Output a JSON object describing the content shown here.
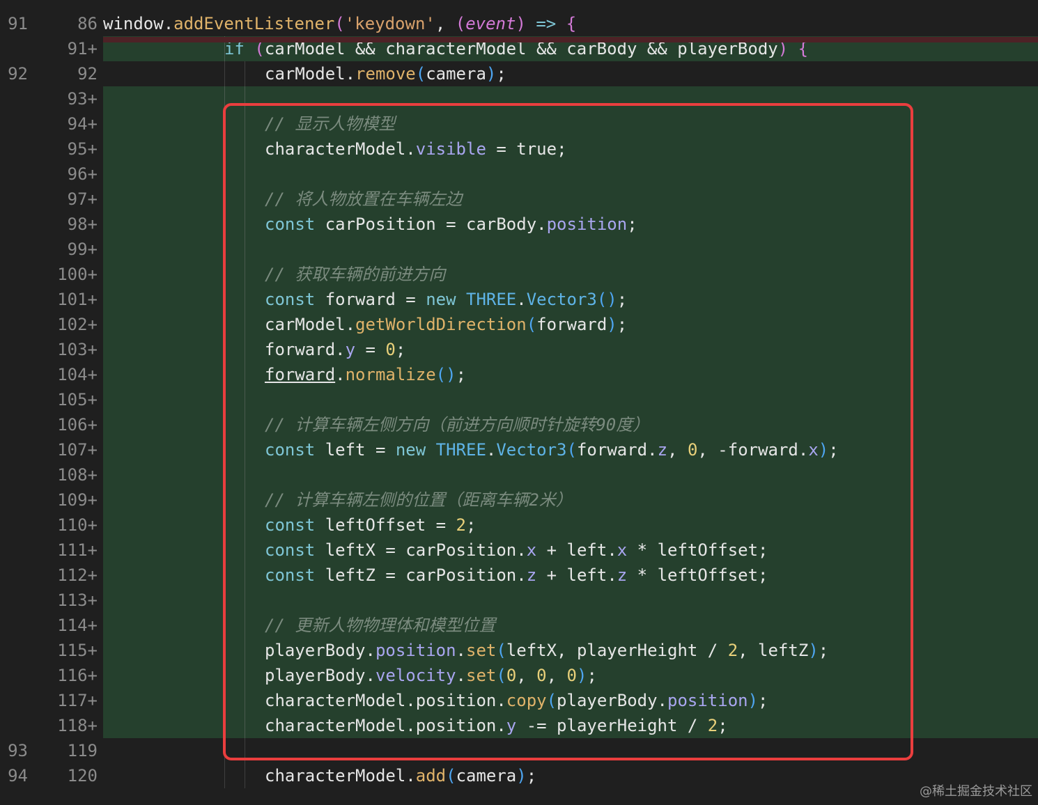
{
  "editor": {
    "lines": [
      {
        "old": "91",
        "new": "86",
        "type": "context",
        "indent": 0,
        "tokens": [
          {
            "t": "window",
            "c": "id"
          },
          {
            "t": ".",
            "c": "op"
          },
          {
            "t": "addEventListener",
            "c": "fn"
          },
          {
            "t": "(",
            "c": "pp"
          },
          {
            "t": "'keydown'",
            "c": "str"
          },
          {
            "t": ", ",
            "c": "op"
          },
          {
            "t": "(",
            "c": "pp"
          },
          {
            "t": "event",
            "c": "par"
          },
          {
            "t": ")",
            "c": "pp"
          },
          {
            "t": " => ",
            "c": "kw"
          },
          {
            "t": "{",
            "c": "pp"
          }
        ]
      },
      {
        "old": "",
        "new": "91+",
        "type": "added",
        "indent": 1,
        "tokens": [
          {
            "t": "if ",
            "c": "kw"
          },
          {
            "t": "(",
            "c": "pp"
          },
          {
            "t": "carModel && characterModel && carBody && playerBody",
            "c": "id"
          },
          {
            "t": ") ",
            "c": "pp"
          },
          {
            "t": "{",
            "c": "pp"
          }
        ]
      },
      {
        "old": "92",
        "new": "92",
        "type": "context",
        "indent": 2,
        "tokens": [
          {
            "t": "carModel",
            "c": "id"
          },
          {
            "t": ".",
            "c": "op"
          },
          {
            "t": "remove",
            "c": "fn"
          },
          {
            "t": "(",
            "c": "pn"
          },
          {
            "t": "camera",
            "c": "id"
          },
          {
            "t": ")",
            "c": "pn"
          },
          {
            "t": ";",
            "c": "op"
          }
        ]
      },
      {
        "old": "",
        "new": "93+",
        "type": "added",
        "indent": 2,
        "tokens": []
      },
      {
        "old": "",
        "new": "94+",
        "type": "added",
        "indent": 2,
        "tokens": [
          {
            "t": "// 显示人物模型",
            "c": "cmt"
          }
        ]
      },
      {
        "old": "",
        "new": "95+",
        "type": "added",
        "indent": 2,
        "tokens": [
          {
            "t": "characterModel",
            "c": "id"
          },
          {
            "t": ".",
            "c": "op"
          },
          {
            "t": "visible",
            "c": "prop"
          },
          {
            "t": " = ",
            "c": "op"
          },
          {
            "t": "true",
            "c": "id"
          },
          {
            "t": ";",
            "c": "op"
          }
        ]
      },
      {
        "old": "",
        "new": "96+",
        "type": "added",
        "indent": 2,
        "tokens": []
      },
      {
        "old": "",
        "new": "97+",
        "type": "added",
        "indent": 2,
        "tokens": [
          {
            "t": "// 将人物放置在车辆左边",
            "c": "cmt"
          }
        ]
      },
      {
        "old": "",
        "new": "98+",
        "type": "added",
        "indent": 2,
        "tokens": [
          {
            "t": "const ",
            "c": "kw"
          },
          {
            "t": "carPosition = carBody",
            "c": "id"
          },
          {
            "t": ".",
            "c": "op"
          },
          {
            "t": "position",
            "c": "prop"
          },
          {
            "t": ";",
            "c": "op"
          }
        ]
      },
      {
        "old": "",
        "new": "99+",
        "type": "added",
        "indent": 2,
        "tokens": []
      },
      {
        "old": "",
        "new": "100+",
        "type": "added",
        "indent": 2,
        "tokens": [
          {
            "t": "// 获取车辆的前进方向",
            "c": "cmt"
          }
        ]
      },
      {
        "old": "",
        "new": "101+",
        "type": "added",
        "indent": 2,
        "tokens": [
          {
            "t": "const ",
            "c": "kw"
          },
          {
            "t": "forward = ",
            "c": "id"
          },
          {
            "t": "new ",
            "c": "kw"
          },
          {
            "t": "THREE",
            "c": "cls"
          },
          {
            "t": ".",
            "c": "op"
          },
          {
            "t": "Vector3",
            "c": "cls"
          },
          {
            "t": "()",
            "c": "pn"
          },
          {
            "t": ";",
            "c": "op"
          }
        ]
      },
      {
        "old": "",
        "new": "102+",
        "type": "added",
        "indent": 2,
        "tokens": [
          {
            "t": "carModel",
            "c": "id"
          },
          {
            "t": ".",
            "c": "op"
          },
          {
            "t": "getWorldDirection",
            "c": "fn"
          },
          {
            "t": "(",
            "c": "pn"
          },
          {
            "t": "forward",
            "c": "id"
          },
          {
            "t": ")",
            "c": "pn"
          },
          {
            "t": ";",
            "c": "op"
          }
        ]
      },
      {
        "old": "",
        "new": "103+",
        "type": "added",
        "indent": 2,
        "tokens": [
          {
            "t": "forward",
            "c": "id"
          },
          {
            "t": ".",
            "c": "op"
          },
          {
            "t": "y",
            "c": "prop"
          },
          {
            "t": " = ",
            "c": "op"
          },
          {
            "t": "0",
            "c": "num"
          },
          {
            "t": ";",
            "c": "op"
          }
        ]
      },
      {
        "old": "",
        "new": "104+",
        "type": "added",
        "indent": 2,
        "tokens": [
          {
            "t": "forward",
            "c": "id under"
          },
          {
            "t": ".",
            "c": "op"
          },
          {
            "t": "normalize",
            "c": "fn"
          },
          {
            "t": "()",
            "c": "pn"
          },
          {
            "t": ";",
            "c": "op"
          }
        ]
      },
      {
        "old": "",
        "new": "105+",
        "type": "added",
        "indent": 2,
        "tokens": []
      },
      {
        "old": "",
        "new": "106+",
        "type": "added",
        "indent": 2,
        "tokens": [
          {
            "t": "// 计算车辆左侧方向（前进方向顺时针旋转90度）",
            "c": "cmt"
          }
        ]
      },
      {
        "old": "",
        "new": "107+",
        "type": "added",
        "indent": 2,
        "tokens": [
          {
            "t": "const ",
            "c": "kw"
          },
          {
            "t": "left = ",
            "c": "id"
          },
          {
            "t": "new ",
            "c": "kw"
          },
          {
            "t": "THREE",
            "c": "cls"
          },
          {
            "t": ".",
            "c": "op"
          },
          {
            "t": "Vector3",
            "c": "cls"
          },
          {
            "t": "(",
            "c": "pn"
          },
          {
            "t": "forward",
            "c": "id"
          },
          {
            "t": ".",
            "c": "op"
          },
          {
            "t": "z",
            "c": "prop"
          },
          {
            "t": ", ",
            "c": "op"
          },
          {
            "t": "0",
            "c": "num"
          },
          {
            "t": ", -forward",
            "c": "id"
          },
          {
            "t": ".",
            "c": "op"
          },
          {
            "t": "x",
            "c": "prop"
          },
          {
            "t": ")",
            "c": "pn"
          },
          {
            "t": ";",
            "c": "op"
          }
        ]
      },
      {
        "old": "",
        "new": "108+",
        "type": "added",
        "indent": 2,
        "tokens": []
      },
      {
        "old": "",
        "new": "109+",
        "type": "added",
        "indent": 2,
        "tokens": [
          {
            "t": "// 计算车辆左侧的位置（距离车辆2米）",
            "c": "cmt"
          }
        ]
      },
      {
        "old": "",
        "new": "110+",
        "type": "added",
        "indent": 2,
        "tokens": [
          {
            "t": "const ",
            "c": "kw"
          },
          {
            "t": "leftOffset = ",
            "c": "id"
          },
          {
            "t": "2",
            "c": "num"
          },
          {
            "t": ";",
            "c": "op"
          }
        ]
      },
      {
        "old": "",
        "new": "111+",
        "type": "added",
        "indent": 2,
        "tokens": [
          {
            "t": "const ",
            "c": "kw"
          },
          {
            "t": "leftX = carPosition",
            "c": "id"
          },
          {
            "t": ".",
            "c": "op"
          },
          {
            "t": "x",
            "c": "prop"
          },
          {
            "t": " + left",
            "c": "id"
          },
          {
            "t": ".",
            "c": "op"
          },
          {
            "t": "x",
            "c": "prop"
          },
          {
            "t": " * leftOffset;",
            "c": "id"
          }
        ]
      },
      {
        "old": "",
        "new": "112+",
        "type": "added",
        "indent": 2,
        "tokens": [
          {
            "t": "const ",
            "c": "kw"
          },
          {
            "t": "leftZ = carPosition",
            "c": "id"
          },
          {
            "t": ".",
            "c": "op"
          },
          {
            "t": "z",
            "c": "prop"
          },
          {
            "t": " + left",
            "c": "id"
          },
          {
            "t": ".",
            "c": "op"
          },
          {
            "t": "z",
            "c": "prop"
          },
          {
            "t": " * leftOffset;",
            "c": "id"
          }
        ]
      },
      {
        "old": "",
        "new": "113+",
        "type": "added",
        "indent": 2,
        "tokens": []
      },
      {
        "old": "",
        "new": "114+",
        "type": "added",
        "indent": 2,
        "tokens": [
          {
            "t": "// 更新人物物理体和模型位置",
            "c": "cmt"
          }
        ]
      },
      {
        "old": "",
        "new": "115+",
        "type": "added",
        "indent": 2,
        "tokens": [
          {
            "t": "playerBody",
            "c": "id"
          },
          {
            "t": ".",
            "c": "op"
          },
          {
            "t": "position",
            "c": "prop"
          },
          {
            "t": ".",
            "c": "op"
          },
          {
            "t": "set",
            "c": "fn"
          },
          {
            "t": "(",
            "c": "pn"
          },
          {
            "t": "leftX, playerHeight / ",
            "c": "id"
          },
          {
            "t": "2",
            "c": "num"
          },
          {
            "t": ", leftZ",
            "c": "id"
          },
          {
            "t": ")",
            "c": "pn"
          },
          {
            "t": ";",
            "c": "op"
          }
        ]
      },
      {
        "old": "",
        "new": "116+",
        "type": "added",
        "indent": 2,
        "tokens": [
          {
            "t": "playerBody",
            "c": "id"
          },
          {
            "t": ".",
            "c": "op"
          },
          {
            "t": "velocity",
            "c": "prop"
          },
          {
            "t": ".",
            "c": "op"
          },
          {
            "t": "set",
            "c": "fn"
          },
          {
            "t": "(",
            "c": "pn"
          },
          {
            "t": "0",
            "c": "num"
          },
          {
            "t": ", ",
            "c": "op"
          },
          {
            "t": "0",
            "c": "num"
          },
          {
            "t": ", ",
            "c": "op"
          },
          {
            "t": "0",
            "c": "num"
          },
          {
            "t": ")",
            "c": "pn"
          },
          {
            "t": ";",
            "c": "op"
          }
        ]
      },
      {
        "old": "",
        "new": "117+",
        "type": "added",
        "indent": 2,
        "tokens": [
          {
            "t": "characterModel",
            "c": "id"
          },
          {
            "t": ".",
            "c": "op"
          },
          {
            "t": "position",
            "c": "id"
          },
          {
            "t": ".",
            "c": "op"
          },
          {
            "t": "copy",
            "c": "fn"
          },
          {
            "t": "(",
            "c": "pn"
          },
          {
            "t": "playerBody",
            "c": "id"
          },
          {
            "t": ".",
            "c": "op"
          },
          {
            "t": "position",
            "c": "prop"
          },
          {
            "t": ")",
            "c": "pn"
          },
          {
            "t": ";",
            "c": "op"
          }
        ]
      },
      {
        "old": "",
        "new": "118+",
        "type": "added",
        "indent": 2,
        "tokens": [
          {
            "t": "characterModel",
            "c": "id"
          },
          {
            "t": ".",
            "c": "op"
          },
          {
            "t": "position",
            "c": "id"
          },
          {
            "t": ".",
            "c": "op"
          },
          {
            "t": "y",
            "c": "prop"
          },
          {
            "t": " -= playerHeight / ",
            "c": "id"
          },
          {
            "t": "2",
            "c": "num"
          },
          {
            "t": ";",
            "c": "op"
          }
        ]
      },
      {
        "old": "93",
        "new": "119",
        "type": "context",
        "indent": 2,
        "tokens": []
      },
      {
        "old": "94",
        "new": "120",
        "type": "context",
        "indent": 2,
        "tokens": [
          {
            "t": "characterModel",
            "c": "id"
          },
          {
            "t": ".",
            "c": "op"
          },
          {
            "t": "add",
            "c": "fn"
          },
          {
            "t": "(",
            "c": "pn"
          },
          {
            "t": "camera",
            "c": "id"
          },
          {
            "t": ")",
            "c": "pn"
          },
          {
            "t": ";",
            "c": "op"
          }
        ]
      }
    ]
  },
  "watermark": "@稀土掘金技术社区"
}
